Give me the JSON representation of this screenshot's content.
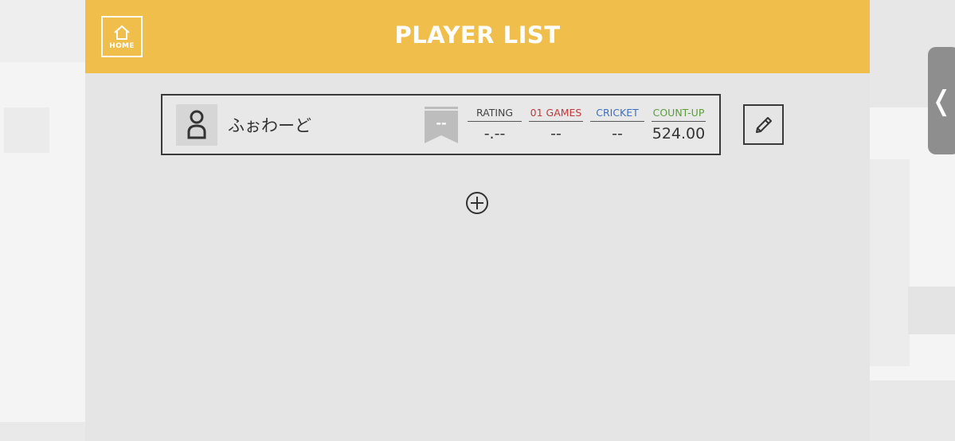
{
  "header": {
    "title": "PLAYER LIST",
    "home_label": "HOME",
    "background_color": "#f0be4b"
  },
  "players": [
    {
      "name": "ふぉわーど",
      "rank": "--",
      "stats": {
        "rating": {
          "label": "RATING",
          "value": "-.--",
          "color": "#444444"
        },
        "games01": {
          "label": "01 GAMES",
          "value": "--",
          "color": "#c0393b"
        },
        "cricket": {
          "label": "CRICKET",
          "value": "--",
          "color": "#3d6fc1"
        },
        "countup": {
          "label": "COUNT-UP",
          "value": "524.00",
          "color": "#5a9e3a"
        }
      }
    }
  ],
  "side_tab": {
    "glyph": "❬"
  },
  "icons": {
    "home": "home-icon",
    "avatar": "person-icon",
    "edit": "pencil-icon",
    "add": "plus-circle-icon",
    "rank": "ribbon-badge-icon"
  }
}
